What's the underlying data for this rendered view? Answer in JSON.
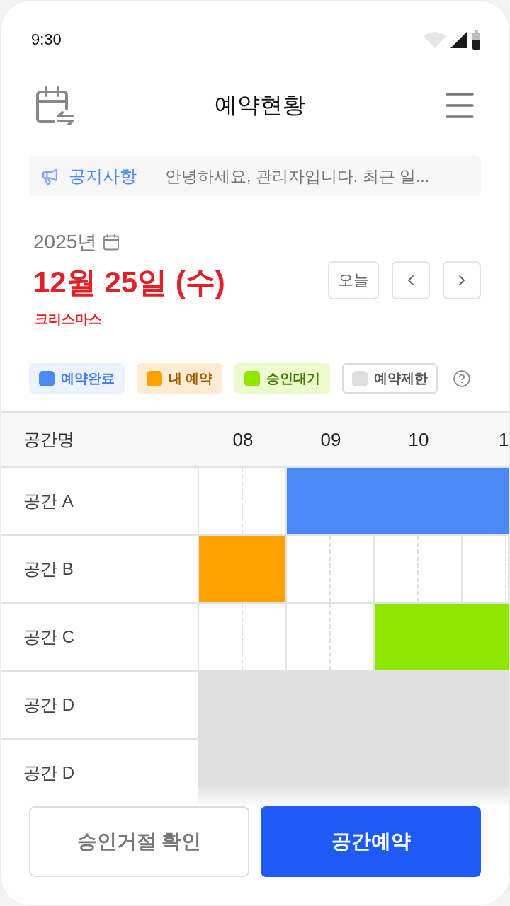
{
  "status_bar": {
    "time": "9:30"
  },
  "header": {
    "title": "예약현황"
  },
  "notice": {
    "label": "공지사항",
    "text": "안녕하세요, 관리자입니다. 최근 일..."
  },
  "date": {
    "year": "2025년",
    "date": "12월 25일 (수)",
    "holiday": "크리스마스"
  },
  "nav_buttons": [
    {
      "kind": "today",
      "label": "오늘"
    },
    {
      "kind": "prev"
    },
    {
      "kind": "next"
    }
  ],
  "legend": [
    {
      "kind": "confirmed",
      "label": "예약완료",
      "color": "#4d88f7"
    },
    {
      "kind": "mine",
      "label": "내 예약",
      "color": "#ffa200"
    },
    {
      "kind": "pending",
      "label": "승인대기",
      "color": "#8fe600"
    },
    {
      "kind": "restricted",
      "label": "예약제한",
      "color": "#e0e0e0"
    }
  ],
  "table": {
    "columns": [
      "공간명",
      "08",
      "09",
      "10",
      "1"
    ],
    "rows": [
      {
        "name": "공간 A",
        "slots": [
          {
            "kind": "empty"
          },
          {
            "kind": "confirmed"
          },
          {
            "kind": "confirmed"
          },
          {
            "kind": "confirmed"
          }
        ]
      },
      {
        "name": "공간 B",
        "slots": [
          {
            "kind": "mine"
          },
          {
            "kind": "empty"
          },
          {
            "kind": "empty"
          },
          {
            "kind": "empty"
          }
        ]
      },
      {
        "name": "공간 C",
        "slots": [
          {
            "kind": "empty"
          },
          {
            "kind": "empty"
          },
          {
            "kind": "pending"
          },
          {
            "kind": "pending"
          }
        ]
      },
      {
        "name": "공간 D",
        "slots": [
          {
            "kind": "restricted"
          },
          {
            "kind": "restricted"
          },
          {
            "kind": "restricted"
          },
          {
            "kind": "restricted"
          }
        ]
      },
      {
        "name": "공간 D",
        "slots": [
          {
            "kind": "restricted"
          },
          {
            "kind": "restricted"
          },
          {
            "kind": "restricted"
          },
          {
            "kind": "restricted"
          }
        ]
      }
    ]
  },
  "buttons": [
    {
      "kind": "secondary",
      "label": "승인거절 확인"
    },
    {
      "kind": "primary",
      "label": "공간예약"
    }
  ]
}
